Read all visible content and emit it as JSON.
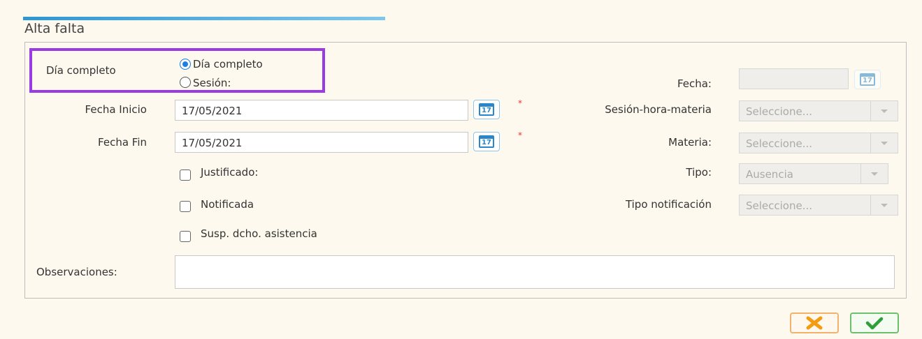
{
  "dialog": {
    "title": "Alta falta"
  },
  "form": {
    "modo_label": "Día completo",
    "radio_dia_completo": "Día completo",
    "radio_sesion": "Sesión:",
    "fecha_inicio_label": "Fecha Inicio",
    "fecha_inicio_value": "17/05/2021",
    "fecha_fin_label": "Fecha Fin",
    "fecha_fin_value": "17/05/2021",
    "justificado_label": "Justificado:",
    "notificada_label": "Notificada",
    "susp_label": "Susp. dcho. asistencia",
    "observaciones_label": "Observaciones:",
    "fecha_label": "Fecha:",
    "sesion_label": "Sesión-hora-materia",
    "sesion_value": "Seleccione...",
    "materia_label": "Materia:",
    "materia_value": "Seleccione...",
    "tipo_label": "Tipo:",
    "tipo_value": "Ausencia",
    "tipo_notif_label": "Tipo notificación",
    "tipo_notif_value": "Seleccione...",
    "calendar_day": "17",
    "required_mark": "*"
  },
  "colors": {
    "accent": "#2b97d6",
    "highlight": "#9b3be3",
    "cancel": "#f39c12",
    "ok": "#2e9e3a"
  },
  "icons": {
    "calendar": "calendar-icon",
    "cancel": "close-icon",
    "confirm": "check-icon"
  }
}
